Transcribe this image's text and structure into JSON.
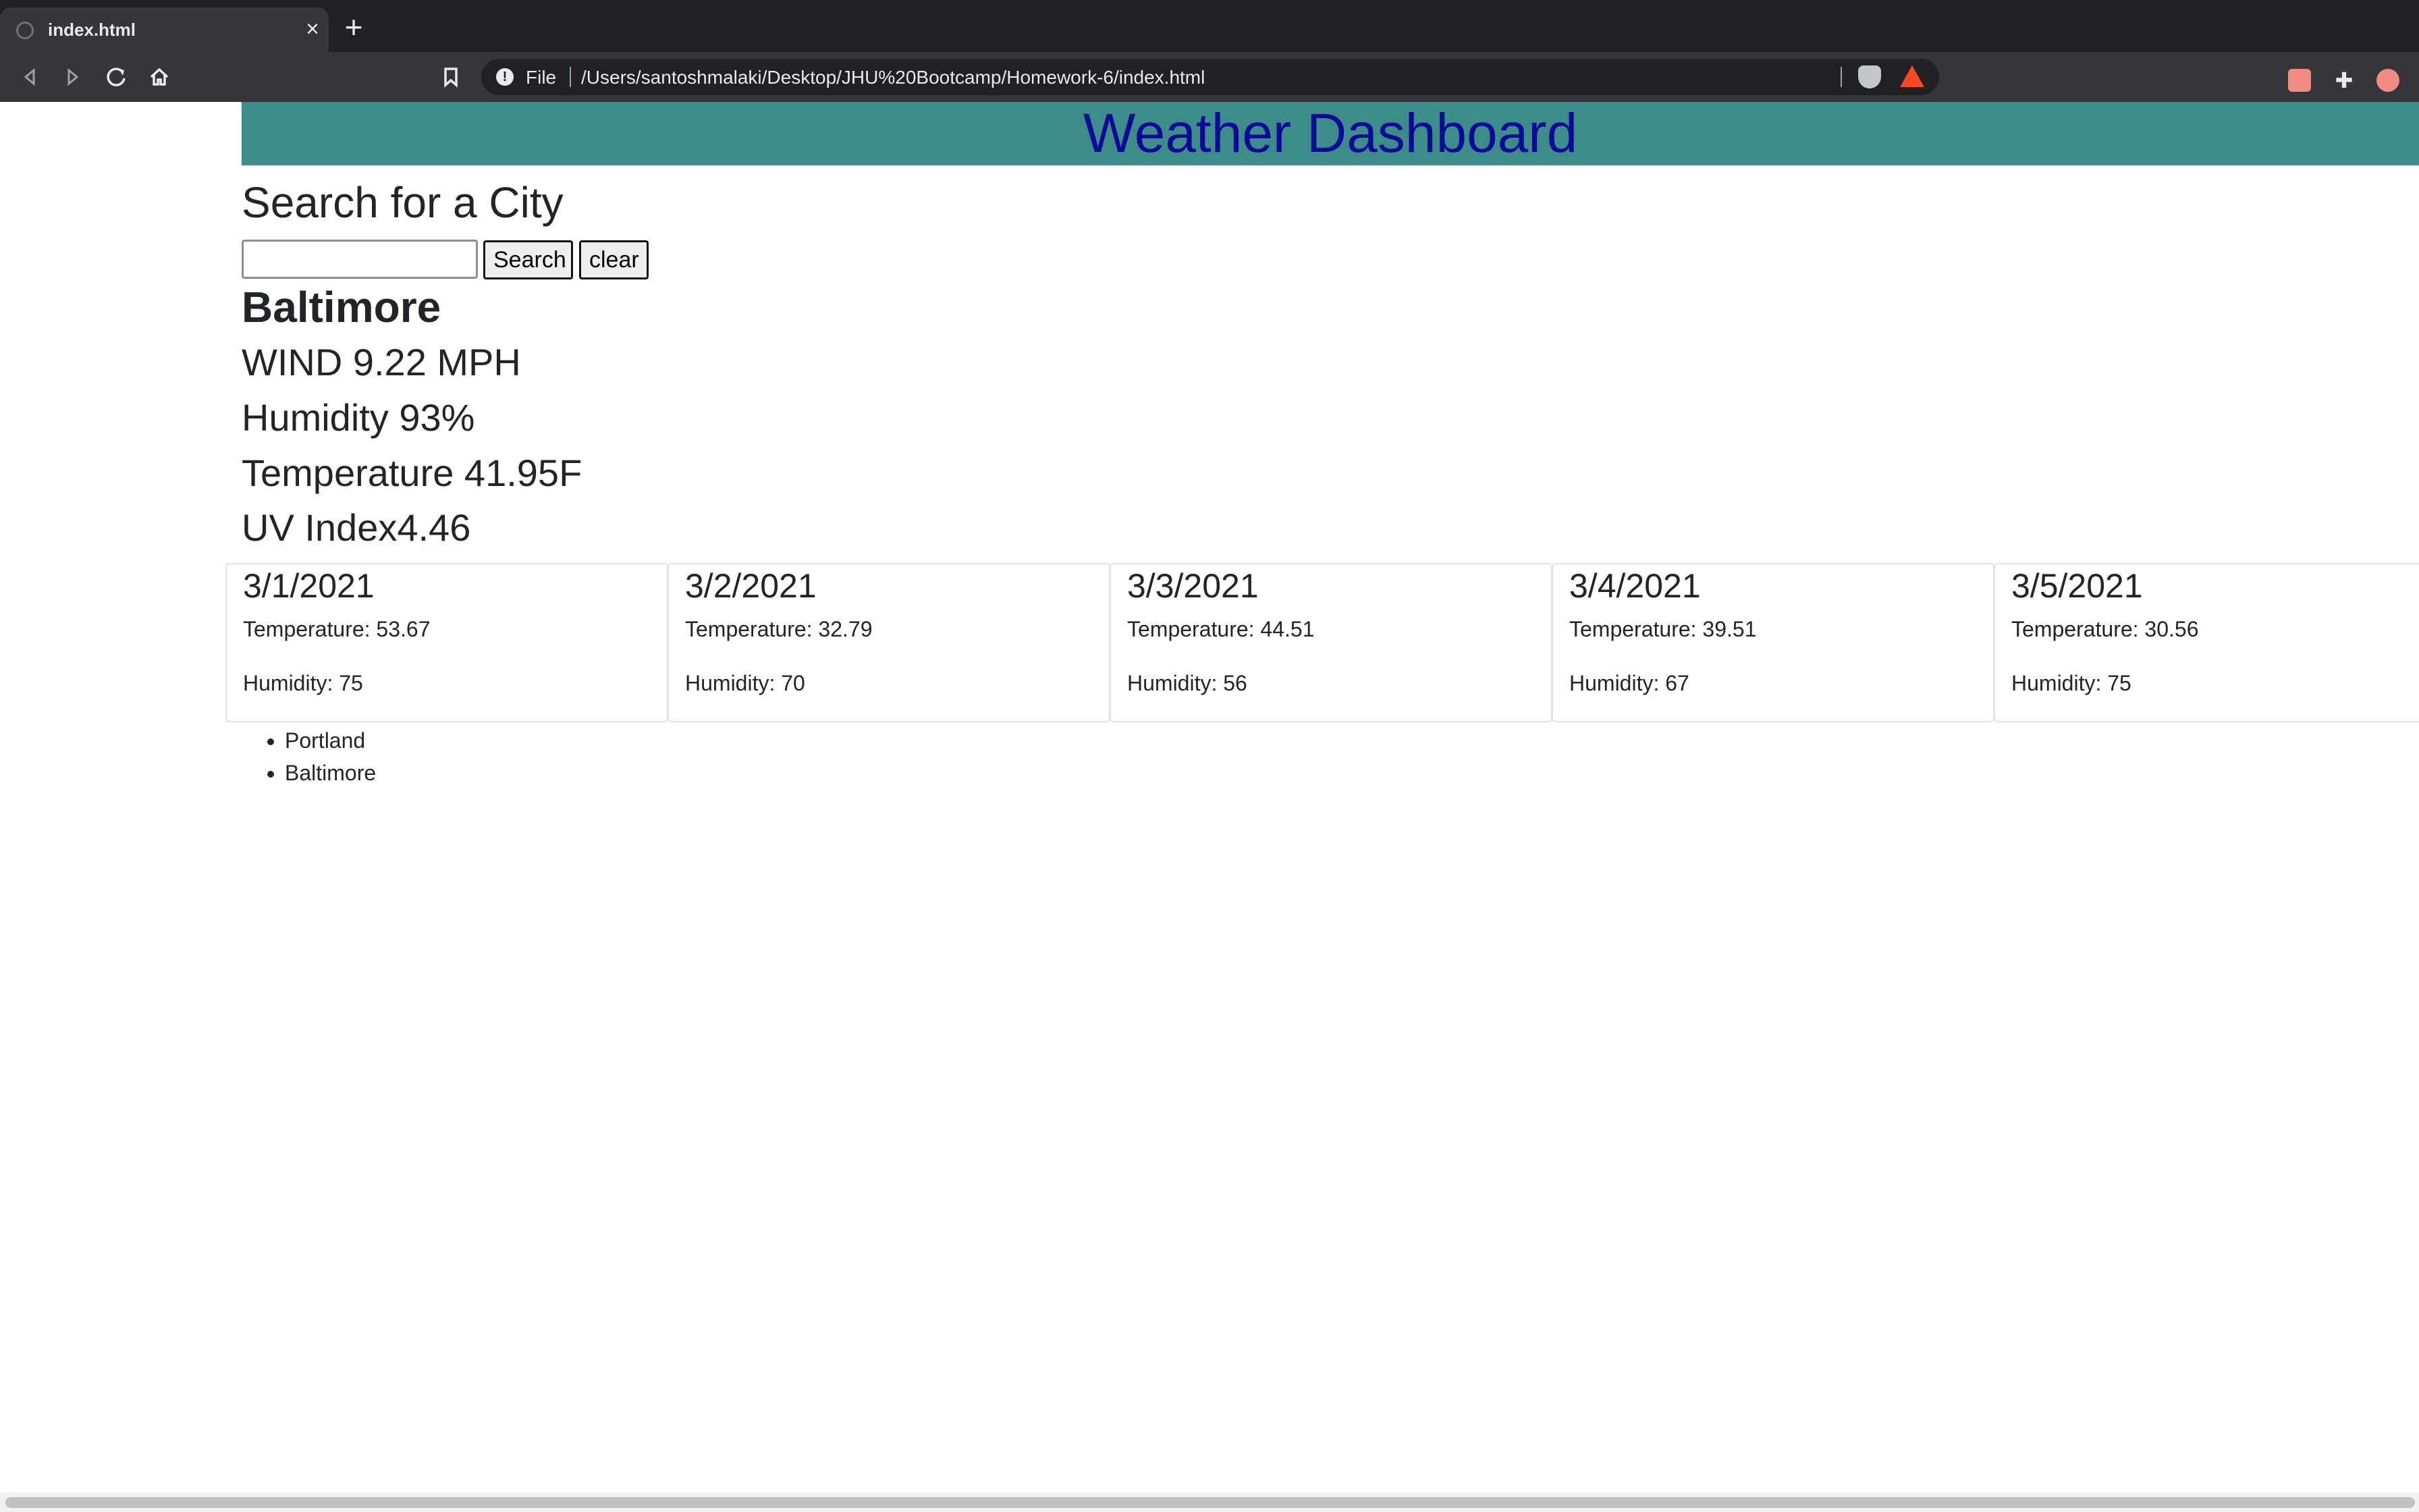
{
  "browser": {
    "tab_title": "index.html",
    "tab_close": "×",
    "new_tab": "+",
    "url_scheme": "File",
    "url": "/Users/santoshmalaki/Desktop/JHU%20Bootcamp/Homework-6/index.html"
  },
  "header": {
    "title": "Weather Dashboard"
  },
  "search": {
    "heading": "Search for a City",
    "input_value": "",
    "search_label": "Search",
    "clear_label": "clear"
  },
  "current": {
    "city": "Baltimore",
    "wind": "WIND 9.22 MPH",
    "humidity": "Humidity 93%",
    "temperature": "Temperature 41.95F",
    "uv": "UV Index4.46"
  },
  "forecast": [
    {
      "date": "3/1/2021",
      "temp": "Temperature: 53.67",
      "humidity": "Humidity: 75"
    },
    {
      "date": "3/2/2021",
      "temp": "Temperature: 32.79",
      "humidity": "Humidity: 70"
    },
    {
      "date": "3/3/2021",
      "temp": "Temperature: 44.51",
      "humidity": "Humidity: 56"
    },
    {
      "date": "3/4/2021",
      "temp": "Temperature: 39.51",
      "humidity": "Humidity: 67"
    },
    {
      "date": "3/5/2021",
      "temp": "Temperature: 30.56",
      "humidity": "Humidity: 75"
    }
  ],
  "history": [
    "Portland",
    "Baltimore"
  ],
  "icons": {
    "back": "back-arrow-icon",
    "forward": "forward-arrow-icon",
    "reload": "reload-icon",
    "home": "home-icon",
    "bookmark": "bookmark-icon",
    "info": "info-icon",
    "brave": "brave-shield-icon",
    "rewards": "brave-rewards-icon",
    "extension": "extensions-puzzle-icon"
  },
  "colors": {
    "header_bg": "#3c8d8a",
    "header_text": "#0a0a99"
  }
}
